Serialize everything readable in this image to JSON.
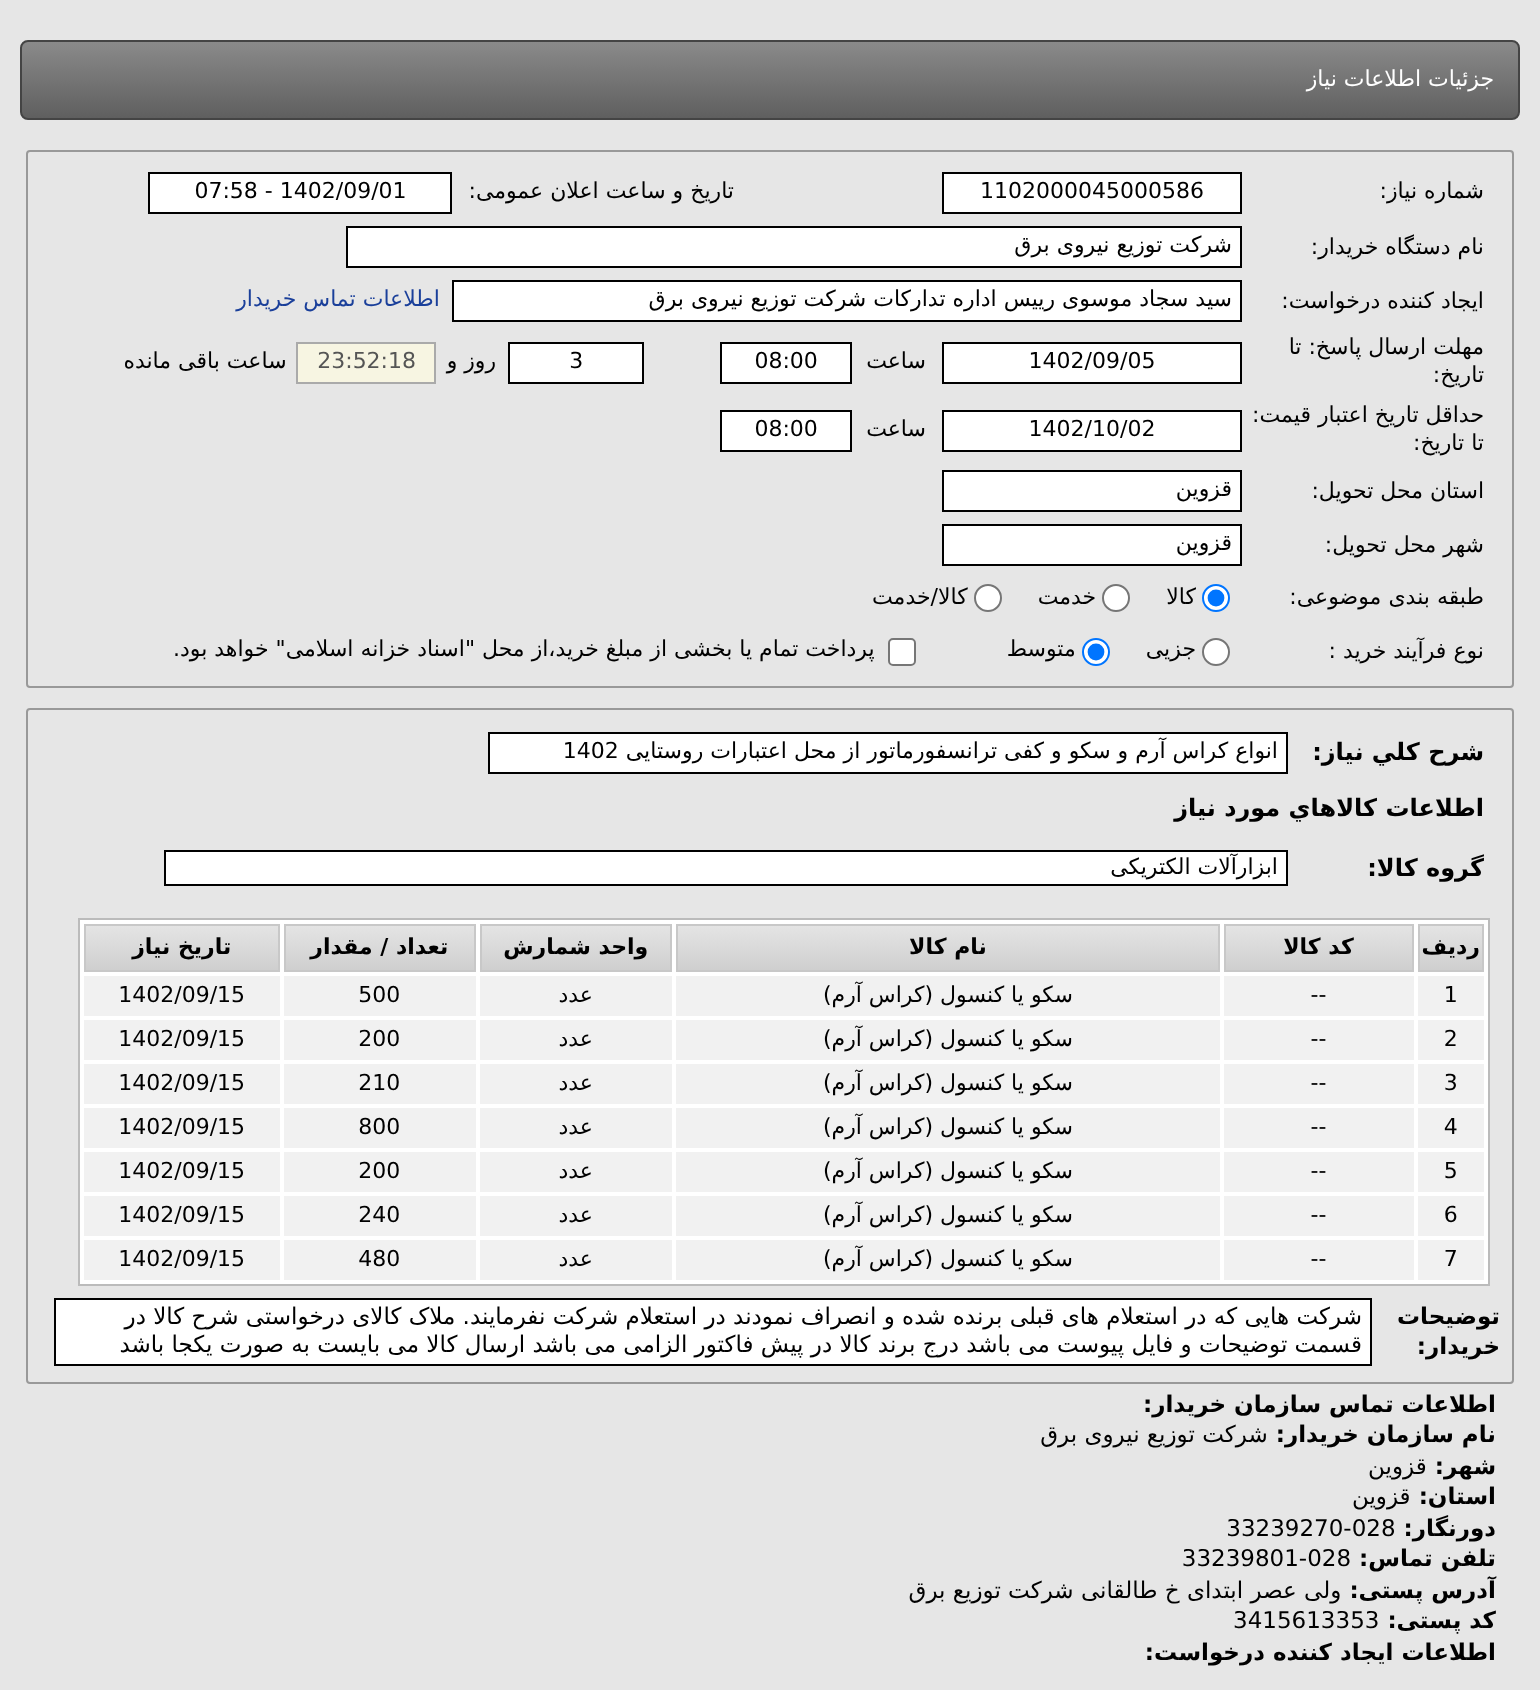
{
  "header": {
    "title": "جزئیات اطلاعات نیاز"
  },
  "general": {
    "need_number": {
      "label": "شماره نیاز:",
      "value": "1102000045000586"
    },
    "announce": {
      "label": "تاریخ و ساعت اعلان عمومی:",
      "value": "1402/09/01 - 07:58"
    },
    "buyer_org": {
      "label": "نام دستگاه خریدار:",
      "value": "شرکت توزیع نیروی برق"
    },
    "creator": {
      "label": "ایجاد کننده درخواست:",
      "value": "سید سجاد موسوی رییس اداره تدارکات شرکت توزیع نیروی برق",
      "link": "اطلاعات تماس خریدار"
    },
    "deadline": {
      "label": "مهلت ارسال پاسخ: تا تاریخ:",
      "date": "1402/09/05",
      "time_label": "ساعت",
      "time": "08:00",
      "days": "3",
      "days_label": "روز و",
      "countdown": "23:52:18",
      "remaining_label": "ساعت باقی مانده"
    },
    "validity": {
      "label": "حداقل تاریخ اعتبار قیمت: تا تاریخ:",
      "date": "1402/10/02",
      "time_label": "ساعت",
      "time": "08:00"
    },
    "province": {
      "label": "استان محل تحویل:",
      "value": "قزوین"
    },
    "city": {
      "label": "شهر محل تحویل:",
      "value": "قزوین"
    },
    "category": {
      "label": "طبقه بندی موضوعی:",
      "options": [
        {
          "label": "کالا",
          "selected": true
        },
        {
          "label": "خدمت",
          "selected": false
        },
        {
          "label": "کالا/خدمت",
          "selected": false
        }
      ]
    },
    "process": {
      "label": "نوع فرآیند خرید :",
      "options": [
        {
          "label": "جزیی",
          "selected": false
        },
        {
          "label": "متوسط",
          "selected": true
        }
      ],
      "payment": {
        "checked": false,
        "text": "پرداخت تمام یا بخشی از مبلغ خرید،از محل \"اسناد خزانه اسلامی\" خواهد بود."
      }
    }
  },
  "items": {
    "summary": {
      "label": "شرح کلي نياز:",
      "value": "انواع کراس آرم و سکو و کفی ترانسفورماتور از محل اعتبارات روستایی 1402"
    },
    "section_title": "اطلاعات کالاهاي مورد نياز",
    "group": {
      "label": "گروه کالا:",
      "value": "ابزارآلات الکتریکی"
    },
    "table": {
      "columns": [
        "ردیف",
        "کد کالا",
        "نام کالا",
        "واحد شمارش",
        "تعداد / مقدار",
        "تاریخ نیاز"
      ],
      "rows": [
        [
          "1",
          "--",
          "سکو یا کنسول (کراس آرم)",
          "عدد",
          "500",
          "1402/09/15"
        ],
        [
          "2",
          "--",
          "سکو یا کنسول (کراس آرم)",
          "عدد",
          "200",
          "1402/09/15"
        ],
        [
          "3",
          "--",
          "سکو یا کنسول (کراس آرم)",
          "عدد",
          "210",
          "1402/09/15"
        ],
        [
          "4",
          "--",
          "سکو یا کنسول (کراس آرم)",
          "عدد",
          "800",
          "1402/09/15"
        ],
        [
          "5",
          "--",
          "سکو یا کنسول (کراس آرم)",
          "عدد",
          "200",
          "1402/09/15"
        ],
        [
          "6",
          "--",
          "سکو یا کنسول (کراس آرم)",
          "عدد",
          "240",
          "1402/09/15"
        ],
        [
          "7",
          "--",
          "سکو یا کنسول (کراس آرم)",
          "عدد",
          "480",
          "1402/09/15"
        ]
      ]
    },
    "notes": {
      "label": "توضیحات خریدار:",
      "text": "شرکت هایی که در استعلام های قبلی برنده شده و انصراف نمودند در استعلام شرکت نفرمایند. ملاک کالای درخواستی شرح کالا در قسمت توضیحات و فایل پیوست می باشد درج برند کالا در پیش فاکتور الزامی می باشد ارسال کالا می بایست به صورت یکجا باشد"
    }
  },
  "contact": {
    "title": "اطلاعات تماس سازمان خریدار:",
    "lines": [
      {
        "label": "نام سازمان خریدار:",
        "value": "شرکت توزیع نیروی برق"
      },
      {
        "label": "شهر:",
        "value": "قزوین"
      },
      {
        "label": "استان:",
        "value": "قزوین"
      },
      {
        "label": "دورنگار:",
        "value": "028-33239270"
      },
      {
        "label": "تلفن تماس:",
        "value": "028-33239801"
      },
      {
        "label": "آدرس پستی:",
        "value": "ولی عصر ابتدای خ طالقانی شرکت توزیع برق"
      },
      {
        "label": "کد پستی:",
        "value": "3415613353"
      }
    ],
    "footer": "اطلاعات ایجاد کننده درخواست:"
  }
}
